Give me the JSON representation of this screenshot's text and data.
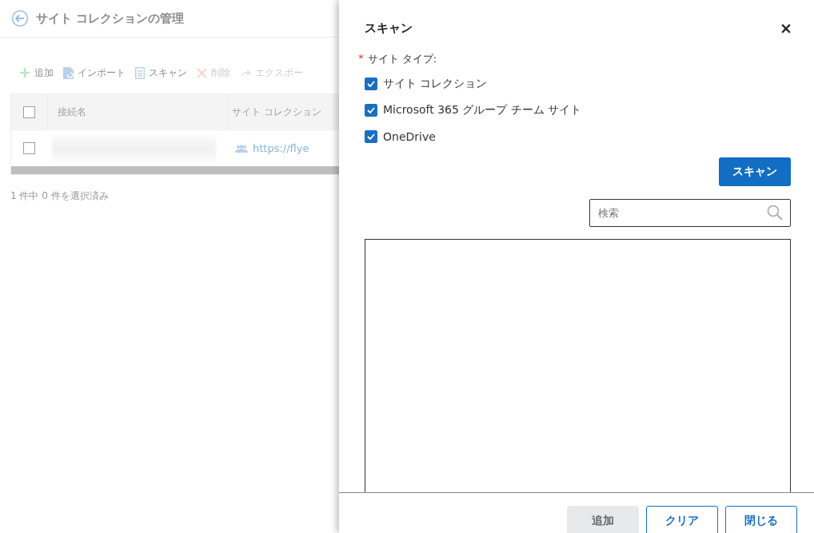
{
  "page": {
    "title": "サイト コレクションの管理",
    "toolbar": [
      {
        "kind": "add",
        "label": "追加",
        "disabled": false
      },
      {
        "kind": "import",
        "label": "インポート",
        "disabled": false
      },
      {
        "kind": "scan",
        "label": "スキャン",
        "disabled": false
      },
      {
        "kind": "delete",
        "label": "削除",
        "disabled": true
      },
      {
        "kind": "export",
        "label": "エクスポー",
        "disabled": true
      }
    ],
    "table": {
      "columns": [
        "接続名",
        "サイト コレクション"
      ],
      "rows": [
        {
          "checked": false,
          "column_1": {
            "kind": "redacted"
          },
          "url": "https://flye"
        }
      ],
      "header_checked": false
    },
    "status": "1 件中 0 件を選択済み"
  },
  "dialog": {
    "title": "スキャン",
    "close": "×",
    "field_label": "サイト タイプ:",
    "required_mark": "*",
    "options": [
      {
        "label": "サイト コレクション",
        "checked": true
      },
      {
        "label": "Microsoft 365 グループ チーム サイト",
        "checked": true
      },
      {
        "label": "OneDrive",
        "checked": true
      }
    ],
    "scan_button": "スキャン",
    "search": {
      "placeholder": "検索"
    },
    "buttons": [
      {
        "label": "追加",
        "disabled": true
      },
      {
        "label": "クリア",
        "disabled": false
      },
      {
        "label": "閉じる",
        "disabled": false
      }
    ]
  }
}
